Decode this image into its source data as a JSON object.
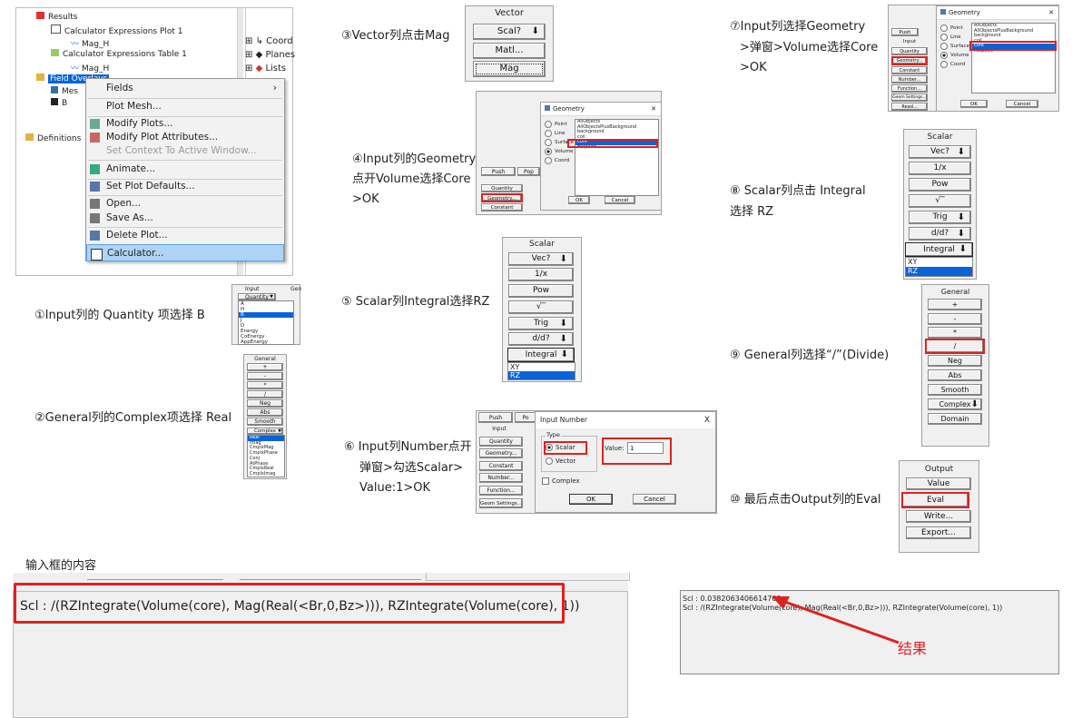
{
  "steps": {
    "s1": "①Input列的 Quantity 项选择 B",
    "s2": "②General列的Complex项选择 Real",
    "s3": "③Vector列点击Mag",
    "s4_l1": "④Input列的Geometry",
    "s4_l2": "点开Volume选择Core",
    "s4_l3": ">OK",
    "s5": "⑤ Scalar列Integral选择RZ",
    "s6_l1": "⑥ Input列Number点开",
    "s6_l2": "弹窗>勾选Scalar>",
    "s6_l3": "Value:1>OK",
    "s7_l1": "⑦Input列选择Geometry",
    "s7_l2": ">弹窗>Volume选择Core",
    "s7_l3": ">OK",
    "s8_l1": "⑧ Scalar列点击 Integral",
    "s8_l2": "选择 RZ",
    "s9": "⑨ General列选择“/”(Divide)",
    "s10": "⑩ 最后点击Output列的Eval"
  },
  "tree": {
    "results": "Results",
    "plot1": "Calculator Expressions Plot 1",
    "magh1": "Mag_H",
    "table1": "Calculator Expressions Table 1",
    "magh2": "Mag_H",
    "field_overlays": "Field Overlays",
    "mes": "Mes",
    "b": "B",
    "definitions": "Definitions",
    "coord": "Coord",
    "planes": "Planes",
    "lists": "Lists",
    "col_input": "Input",
    "col_gen": "Gen"
  },
  "context_menu": {
    "fields": "Fields",
    "plot_mesh": "Plot Mesh...",
    "modify_plots": "Modify Plots...",
    "modify_plot_attr": "Modify Plot Attributes...",
    "set_context": "Set Context To Active Window...",
    "animate": "Animate...",
    "set_defaults": "Set Plot Defaults...",
    "open": "Open...",
    "save_as": "Save As...",
    "delete_plot": "Delete Plot...",
    "calculator": "Calculator..."
  },
  "panel1": {
    "header_input": "Input",
    "header_gen": "Gen",
    "quantity": "Quantity",
    "options": [
      "A",
      "H",
      "B",
      "J",
      "D",
      "Energy",
      "CoEnergy",
      "AppEnergy"
    ]
  },
  "panel2": {
    "title": "General",
    "buttons": [
      "+",
      "-",
      "*",
      "/",
      "Neg",
      "Abs",
      "Smooth"
    ],
    "complex": "Complex",
    "options": [
      "Real",
      "Imag",
      "CmplxMag",
      "CmplxPhase",
      "Conj",
      "AtPhase",
      "CmplxReal",
      "CmplxImag"
    ]
  },
  "vector": {
    "title": "Vector",
    "scal": "Scal?",
    "matl": "Matl...",
    "mag": "Mag"
  },
  "geo_small": {
    "title": "Geometry",
    "push": "Push",
    "pop": "Pop",
    "quantity": "Quantity",
    "geometry": "Geometry...",
    "constant": "Constant",
    "radios": [
      "Point",
      "Line",
      "Surface",
      "Volume",
      "Coord"
    ],
    "list": [
      "AllObjects",
      "AllObjectsPlusBackground",
      "background",
      "coil",
      "core",
      "Helpoint"
    ],
    "ok": "OK",
    "cancel": "Cancel"
  },
  "scalar1": {
    "title": "Scalar",
    "vec": "Vec?",
    "inv": "1/x",
    "pow": "Pow",
    "sqrt": "√‾",
    "trig": "Trig",
    "ddq": "d/d?",
    "integral": "Integral",
    "options": [
      "XY",
      "RZ"
    ]
  },
  "input_number": {
    "push": "Push",
    "pop": "Po",
    "input": "Input",
    "quantity": "Quantity",
    "geometry": "Geometry...",
    "constant": "Constant",
    "number": "Number...",
    "function": "Function...",
    "geom_settings": "Geom Settings...",
    "title": "Input Number",
    "close": "X",
    "type": "Type",
    "scalar": "Scalar",
    "vector": "Vector",
    "value_label": "Value:",
    "value": "1",
    "complex": "Complex",
    "ok": "OK",
    "cancel": "Cancel"
  },
  "geo_big": {
    "title": "Geometry",
    "push": "Push",
    "input": "Input",
    "quantity": "Quantity",
    "geometry": "Geometry...",
    "constant": "Constant",
    "number": "Number...",
    "function": "Function...",
    "geom_settings": "Geom Settings...",
    "read": "Read...",
    "radios": [
      "Point",
      "Line",
      "Surface",
      "Volume",
      "Coord"
    ],
    "list": [
      "AllObjects",
      "AllObjectsPlusBackground",
      "background",
      "coil",
      "core",
      "Helpoint"
    ],
    "ok": "OK",
    "cancel": "Cancel"
  },
  "scalar2": {
    "title": "Scalar",
    "vec": "Vec?",
    "inv": "1/x",
    "pow": "Pow",
    "sqrt": "√‾",
    "trig": "Trig",
    "ddq": "d/d?",
    "integral": "Integral",
    "options": [
      "XY",
      "RZ"
    ]
  },
  "general2": {
    "title": "General",
    "plus": "+",
    "minus": "-",
    "times": "*",
    "divide": "/",
    "neg": "Neg",
    "abs": "Abs",
    "smooth": "Smooth",
    "complex": "Complex",
    "domain": "Domain"
  },
  "output": {
    "title": "Output",
    "value": "Value",
    "eval": "Eval",
    "write": "Write...",
    "export": "Export..."
  },
  "input_box": {
    "caption": "输入框的内容",
    "expression": "Scl : /(RZIntegrate(Volume(core), Mag(Real(<Br,0,Bz>))), RZIntegrate(Volume(core), 1))"
  },
  "result_box": {
    "line1": "Scl : 0.0382063406614769",
    "line2": "Scl : /(RZIntegrate(Volume(core), Mag(Real(<Br,0,Bz>))), RZIntegrate(Volume(core), 1))",
    "annotation": "结果"
  },
  "colors": {
    "red": "#e02020",
    "select_blue": "#0a64d8"
  }
}
